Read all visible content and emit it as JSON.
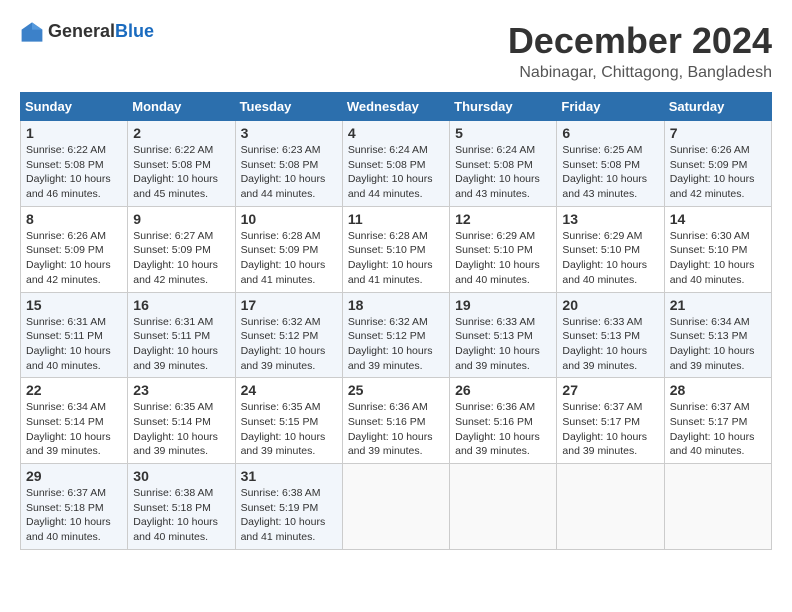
{
  "header": {
    "logo_general": "General",
    "logo_blue": "Blue",
    "title": "December 2024",
    "subtitle": "Nabinagar, Chittagong, Bangladesh"
  },
  "weekdays": [
    "Sunday",
    "Monday",
    "Tuesday",
    "Wednesday",
    "Thursday",
    "Friday",
    "Saturday"
  ],
  "weeks": [
    [
      {
        "day": "1",
        "sunrise": "6:22 AM",
        "sunset": "5:08 PM",
        "daylight": "10 hours and 46 minutes."
      },
      {
        "day": "2",
        "sunrise": "6:22 AM",
        "sunset": "5:08 PM",
        "daylight": "10 hours and 45 minutes."
      },
      {
        "day": "3",
        "sunrise": "6:23 AM",
        "sunset": "5:08 PM",
        "daylight": "10 hours and 44 minutes."
      },
      {
        "day": "4",
        "sunrise": "6:24 AM",
        "sunset": "5:08 PM",
        "daylight": "10 hours and 44 minutes."
      },
      {
        "day": "5",
        "sunrise": "6:24 AM",
        "sunset": "5:08 PM",
        "daylight": "10 hours and 43 minutes."
      },
      {
        "day": "6",
        "sunrise": "6:25 AM",
        "sunset": "5:08 PM",
        "daylight": "10 hours and 43 minutes."
      },
      {
        "day": "7",
        "sunrise": "6:26 AM",
        "sunset": "5:09 PM",
        "daylight": "10 hours and 42 minutes."
      }
    ],
    [
      {
        "day": "8",
        "sunrise": "6:26 AM",
        "sunset": "5:09 PM",
        "daylight": "10 hours and 42 minutes."
      },
      {
        "day": "9",
        "sunrise": "6:27 AM",
        "sunset": "5:09 PM",
        "daylight": "10 hours and 42 minutes."
      },
      {
        "day": "10",
        "sunrise": "6:28 AM",
        "sunset": "5:09 PM",
        "daylight": "10 hours and 41 minutes."
      },
      {
        "day": "11",
        "sunrise": "6:28 AM",
        "sunset": "5:10 PM",
        "daylight": "10 hours and 41 minutes."
      },
      {
        "day": "12",
        "sunrise": "6:29 AM",
        "sunset": "5:10 PM",
        "daylight": "10 hours and 40 minutes."
      },
      {
        "day": "13",
        "sunrise": "6:29 AM",
        "sunset": "5:10 PM",
        "daylight": "10 hours and 40 minutes."
      },
      {
        "day": "14",
        "sunrise": "6:30 AM",
        "sunset": "5:10 PM",
        "daylight": "10 hours and 40 minutes."
      }
    ],
    [
      {
        "day": "15",
        "sunrise": "6:31 AM",
        "sunset": "5:11 PM",
        "daylight": "10 hours and 40 minutes."
      },
      {
        "day": "16",
        "sunrise": "6:31 AM",
        "sunset": "5:11 PM",
        "daylight": "10 hours and 39 minutes."
      },
      {
        "day": "17",
        "sunrise": "6:32 AM",
        "sunset": "5:12 PM",
        "daylight": "10 hours and 39 minutes."
      },
      {
        "day": "18",
        "sunrise": "6:32 AM",
        "sunset": "5:12 PM",
        "daylight": "10 hours and 39 minutes."
      },
      {
        "day": "19",
        "sunrise": "6:33 AM",
        "sunset": "5:13 PM",
        "daylight": "10 hours and 39 minutes."
      },
      {
        "day": "20",
        "sunrise": "6:33 AM",
        "sunset": "5:13 PM",
        "daylight": "10 hours and 39 minutes."
      },
      {
        "day": "21",
        "sunrise": "6:34 AM",
        "sunset": "5:13 PM",
        "daylight": "10 hours and 39 minutes."
      }
    ],
    [
      {
        "day": "22",
        "sunrise": "6:34 AM",
        "sunset": "5:14 PM",
        "daylight": "10 hours and 39 minutes."
      },
      {
        "day": "23",
        "sunrise": "6:35 AM",
        "sunset": "5:14 PM",
        "daylight": "10 hours and 39 minutes."
      },
      {
        "day": "24",
        "sunrise": "6:35 AM",
        "sunset": "5:15 PM",
        "daylight": "10 hours and 39 minutes."
      },
      {
        "day": "25",
        "sunrise": "6:36 AM",
        "sunset": "5:16 PM",
        "daylight": "10 hours and 39 minutes."
      },
      {
        "day": "26",
        "sunrise": "6:36 AM",
        "sunset": "5:16 PM",
        "daylight": "10 hours and 39 minutes."
      },
      {
        "day": "27",
        "sunrise": "6:37 AM",
        "sunset": "5:17 PM",
        "daylight": "10 hours and 39 minutes."
      },
      {
        "day": "28",
        "sunrise": "6:37 AM",
        "sunset": "5:17 PM",
        "daylight": "10 hours and 40 minutes."
      }
    ],
    [
      {
        "day": "29",
        "sunrise": "6:37 AM",
        "sunset": "5:18 PM",
        "daylight": "10 hours and 40 minutes."
      },
      {
        "day": "30",
        "sunrise": "6:38 AM",
        "sunset": "5:18 PM",
        "daylight": "10 hours and 40 minutes."
      },
      {
        "day": "31",
        "sunrise": "6:38 AM",
        "sunset": "5:19 PM",
        "daylight": "10 hours and 41 minutes."
      },
      null,
      null,
      null,
      null
    ]
  ]
}
